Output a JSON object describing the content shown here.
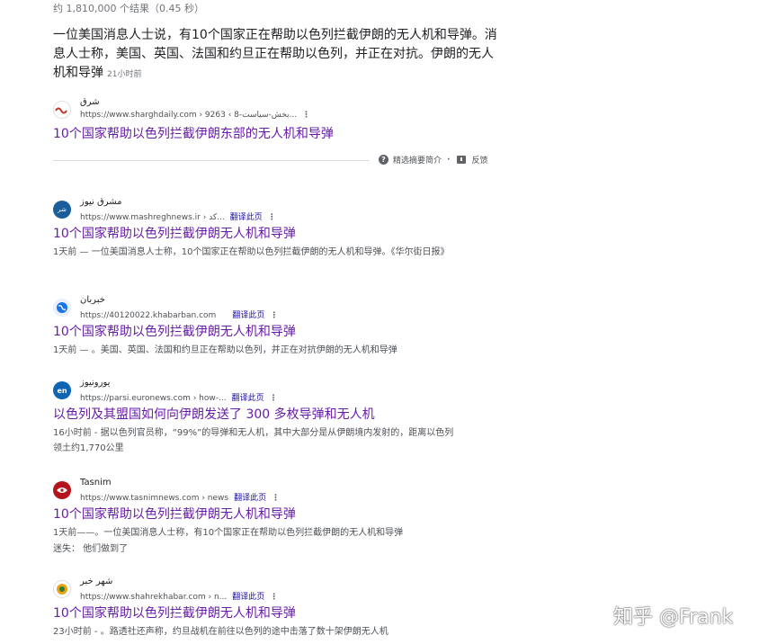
{
  "stats": "约 1,810,000 个结果（0.45 秒）",
  "featured": {
    "snippet": "一位美国消息人士说，有10个国家正在帮助以色列拦截伊朗的无人机和导弹。消息人士称，美国、英国、法国和约旦正在帮助以色列，并正在对抗。伊朗的无人机和导弹",
    "time": "21小时前",
    "source": "شرق",
    "url": "https://www.sharghdaily.com › بخش-سیاست-8 › 9263...",
    "title": "10个国家帮助以色列拦截伊朗东部的无人机和导弹",
    "about_label": "精选摘要简介",
    "feedback_label": "反馈"
  },
  "results": [
    {
      "source": "مشرق نیوز",
      "url": "https://www.mashreghnews.ir › کد...",
      "translate": "翻译此页",
      "title": "10个国家帮助以色列拦截伊朗无人机和导弹",
      "desc": "1天前 — 一位美国消息人士称，10个国家正在帮助以色列拦截伊朗的无人机和导弹。《华尔街日报》",
      "favicon": "mashregh-icon",
      "color": "#1a5d9a"
    },
    {
      "source": "خبربان",
      "url": "https://40120022.khabarban.com",
      "translate": "翻译此页",
      "title": "10个国家帮助以色列拦截伊朗无人机和导弹",
      "desc": "1天前 — 。美国、英国、法国和约旦正在帮助以色列，并正在对抗伊朗的无人机和导弹",
      "favicon": "globe-icon",
      "color": "#1a73e8"
    },
    {
      "source": "یورونیوز",
      "url": "https://parsi.euronews.com › how-...",
      "translate": "翻译此页",
      "title": "以色列及其盟国如何向伊朗发送了 300 多枚导弹和无人机",
      "desc": "16小时前 - 据以色列官员称，“99%”的导弹和无人机，其中大部分是从伊朗境内发射的，距离以色列领土约1,770公里",
      "favicon": "euronews-icon",
      "color": "#0f64b4"
    },
    {
      "source": "Tasnim",
      "url": "https://www.tasnimnews.com › news",
      "translate": "翻译此页",
      "title": "10个国家帮助以色列拦截伊朗无人机和导弹",
      "desc": "1天前——。一位美国消息人士称，有10个国家正在帮助以色列拦截伊朗的无人机和导弹",
      "extra": "迷失：  他们做到了",
      "favicon": "tasnim-icon",
      "color": "#b3141d"
    },
    {
      "source": "شهر خبر",
      "url": "https://www.shahrekhabar.com › n...",
      "translate": "翻译此页",
      "title": "10个国家帮助以色列拦截伊朗无人机和导弹",
      "desc": "23小时前 - 。路透社还声称，约旦战机在前往以色列的途中击落了数十架伊朗无人机",
      "favicon": "shahrekhabar-icon",
      "color": "#e8a317"
    }
  ],
  "watermark": "知乎 @Frank"
}
